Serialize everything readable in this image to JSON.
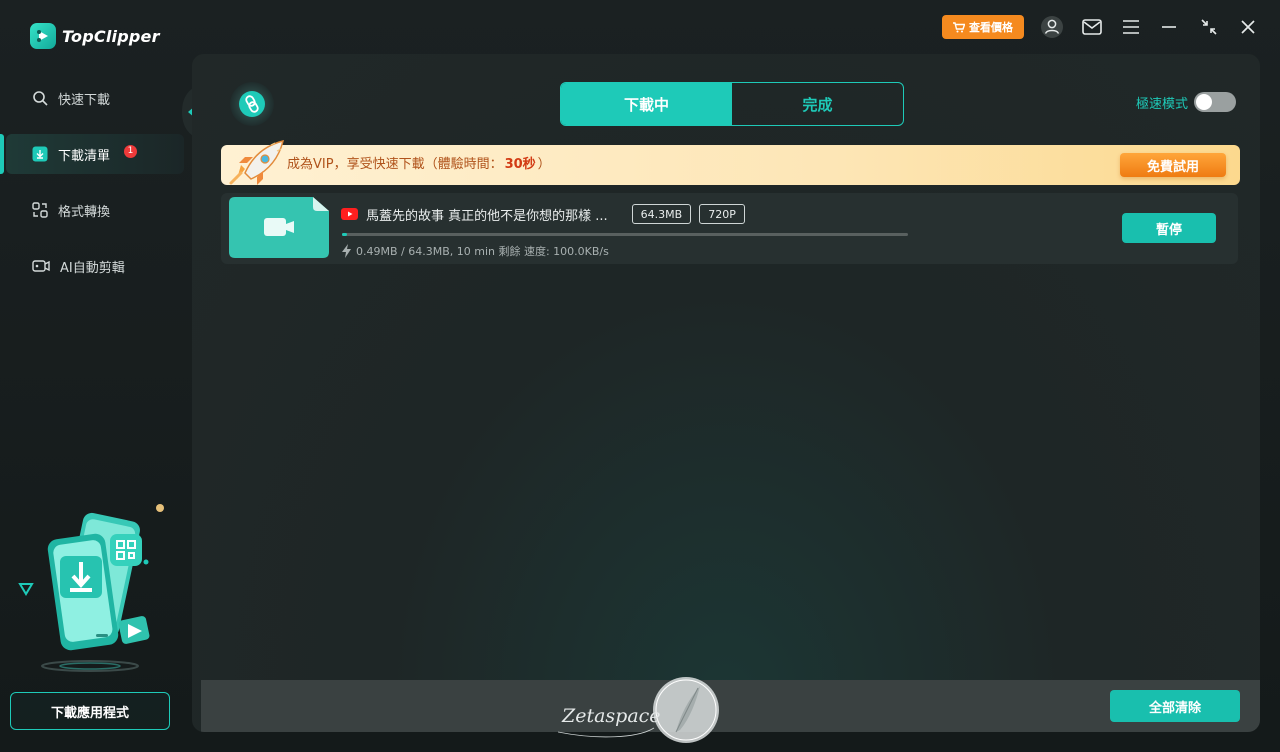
{
  "app": {
    "brand": "TopClipper",
    "accent": "#1ecab8",
    "price_button": "查看價格"
  },
  "titlebar": {
    "icons": [
      "account-icon",
      "mail-icon",
      "menu-icon",
      "minimize-icon",
      "shrink-icon",
      "close-icon"
    ]
  },
  "sidebar": {
    "items": [
      {
        "label": "快速下載",
        "icon": "search-icon"
      },
      {
        "label": "下載清單",
        "icon": "download-list-icon",
        "badge": "1"
      },
      {
        "label": "格式轉換",
        "icon": "convert-icon"
      },
      {
        "label": "AI自動剪輯",
        "icon": "ai-edit-icon"
      }
    ],
    "download_app": "下載應用程式"
  },
  "main": {
    "tabs": [
      "下載中",
      "完成"
    ],
    "speed_mode_label": "極速模式",
    "speed_mode_on": false,
    "vip": {
      "text": "成為VIP，享受快速下載（體驗時間：",
      "seconds": "30秒",
      "closing": "）",
      "button": "免費試用"
    },
    "task": {
      "source_icon": "youtube-icon",
      "title": "馬蓋先的故事 真正的他不是你想的那樣 ...",
      "size": "64.3MB",
      "quality": "720P",
      "progress": 0.008,
      "status": "0.49MB / 64.3MB, 10 min 剩餘 速度: 100.0KB/s",
      "pause": "暫停"
    },
    "clear_all": "全部清除",
    "watermark": "Zetaspace"
  }
}
